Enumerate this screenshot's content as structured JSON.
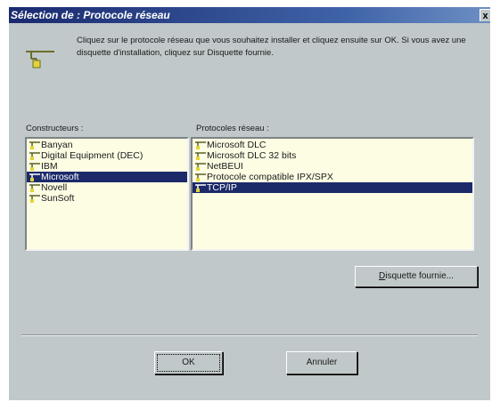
{
  "dialog": {
    "title": "Sélection de : Protocole réseau",
    "close_label": "x",
    "intro_text": "Cliquez sur le protocole réseau que vous souhaitez installer et cliquez ensuite sur OK. Si vous avez une disquette d'installation, cliquez sur Disquette fournie."
  },
  "manufacturers": {
    "label": "Constructeurs :",
    "items": [
      {
        "label": "Banyan",
        "selected": false
      },
      {
        "label": "Digital Equipment (DEC)",
        "selected": false
      },
      {
        "label": "IBM",
        "selected": false
      },
      {
        "label": "Microsoft",
        "selected": true
      },
      {
        "label": "Novell",
        "selected": false
      },
      {
        "label": "SunSoft",
        "selected": false
      }
    ]
  },
  "protocols": {
    "label": "Protocoles réseau :",
    "items": [
      {
        "label": "Microsoft DLC",
        "selected": false
      },
      {
        "label": "Microsoft DLC 32 bits",
        "selected": false
      },
      {
        "label": "NetBEUI",
        "selected": false
      },
      {
        "label": "Protocole compatible IPX/SPX",
        "selected": false
      },
      {
        "label": "TCP/IP",
        "selected": true
      }
    ]
  },
  "buttons": {
    "disk_first_letter": "D",
    "disk_rest": "isquette fournie...",
    "ok": "OK",
    "cancel": "Annuler"
  },
  "colors": {
    "dialog_bg": "#c0c8c9",
    "list_bg": "#fdfde4",
    "selection": "#1c2a6a",
    "title_bar": "#1a2a6e"
  },
  "icons": {
    "network_protocol": "network-protocol-icon"
  }
}
